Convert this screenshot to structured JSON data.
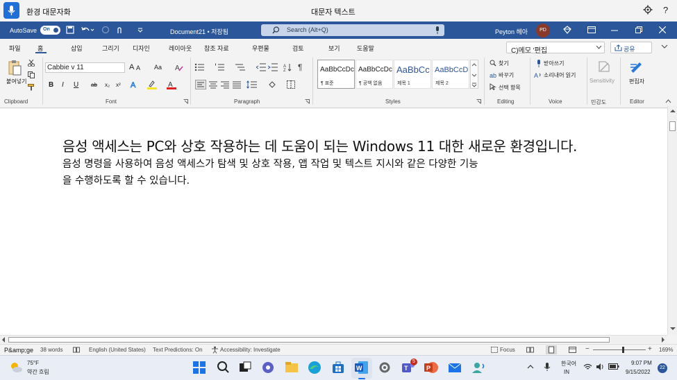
{
  "voice_access": {
    "title": "환경 대문자화",
    "dictation_label": "대문자 텍스트",
    "help": "?"
  },
  "titlebar": {
    "autosave_label": "AutoSave",
    "autosave_state": "On",
    "doc_title": "Document21 • 저장됨",
    "search_placeholder": "Search (Alt+Q)",
    "user_name": "Peyton 헤아",
    "user_initials": "PD"
  },
  "tabs": [
    "파일",
    "홈",
    "삽입",
    "그리기",
    "디자인",
    "레이아웃",
    "참조 자료",
    "우편물",
    "검토",
    "보기",
    "도움말"
  ],
  "comments_label": "C)메모 '편집",
  "share_label": "공유",
  "ribbon": {
    "clipboard": {
      "paste": "붙여넣기",
      "label": "Clipboard"
    },
    "font": {
      "name": "Cabbie v 11",
      "grow": "A",
      "shrink": "A",
      "case": "Aa",
      "bold": "B",
      "italic": "I",
      "underline": "U",
      "strike": "ab",
      "sub": "x₂",
      "sup": "x²",
      "label": "Font"
    },
    "paragraph": {
      "label": "Paragraph"
    },
    "styles": {
      "label": "Styles",
      "items": [
        {
          "preview": "AaBbCcDc",
          "name": "¶ 표준"
        },
        {
          "preview": "AaBbCcDc",
          "name": "¶ 공백 없음"
        },
        {
          "preview": "AaBbCc",
          "name": "제목 1"
        },
        {
          "preview": "AaBbCcD",
          "name": "제목 2"
        }
      ]
    },
    "editing": {
      "find": "찾기",
      "replace": "바꾸기",
      "select": "선택 항목",
      "label": "Editing"
    },
    "voice": {
      "dictate": "받아쓰기",
      "read_aloud": "소리내어 읽기",
      "label": "Voice"
    },
    "sensitivity": {
      "text": "Sensitivity",
      "label": "민감도"
    },
    "editor": {
      "text": "편집자",
      "label": "Editor"
    }
  },
  "document": {
    "line1": "음성 액세스는 PC와 상호 작용하는 데 도움이 되는 Windows 11 대한 새로운 환경입니다.",
    "line2": "음성 명령을 사용하여 음성 액세스가 탐색 및 상호 작용, 앱 작업 및 텍스트 지시와 같은 다양한 기능",
    "line3": "을 수행하도록 할 수 있습니다."
  },
  "statusbar": {
    "page": "P&amp;ge",
    "words": "38 words",
    "language": "English (United States)",
    "predictions": "Text Predictions: On",
    "accessibility": "Accessibility: Investigate",
    "focus": "Focus",
    "zoom": "169%"
  },
  "taskbar": {
    "temp": "75°F",
    "weather": "약간 흐림",
    "lang_top": "한국어",
    "lang_bot": "IN",
    "time": "9:07 PM",
    "date": "9/15/2022",
    "notifications": "22",
    "teams_badge": "5"
  },
  "colors": {
    "word_blue": "#2b579a",
    "accent": "#1f6fd8"
  }
}
